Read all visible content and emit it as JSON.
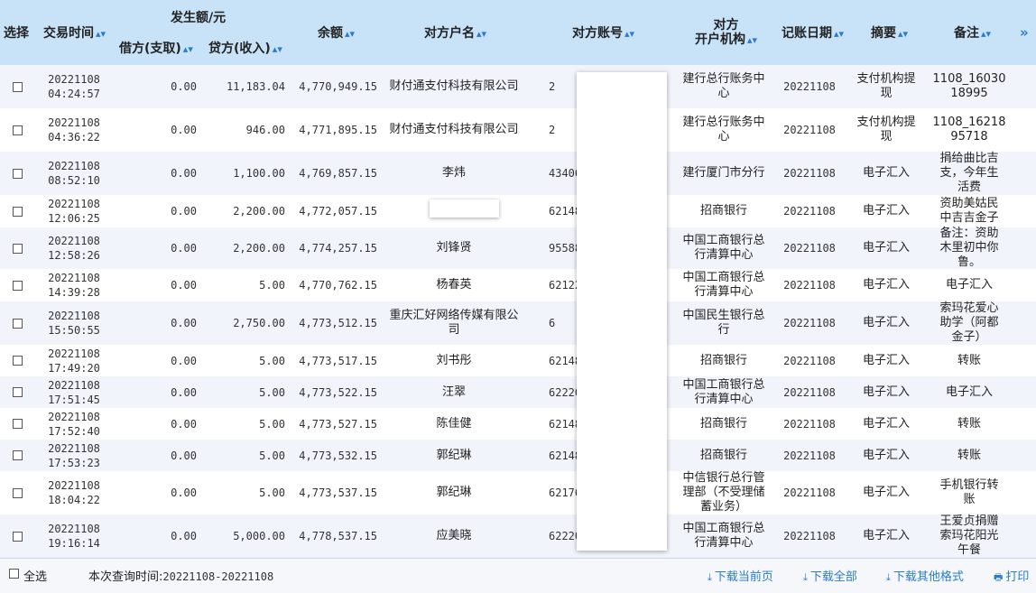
{
  "header": {
    "select": "选择",
    "time": "交易时间",
    "amount_group": "发生额/元",
    "debit": "借方(支取)",
    "credit": "贷方(收入)",
    "balance": "余额",
    "name": "对方户名",
    "account": "对方账号",
    "bank_line1": "对方",
    "bank_line2": "开户机构",
    "date": "记账日期",
    "summary": "摘要",
    "remark": "备注",
    "sort_glyph": "▴▾",
    "more": "»"
  },
  "rows": [
    {
      "d": "20221108",
      "t": "04:24:57",
      "debit": "0.00",
      "credit": "11,183.04",
      "balance": "4,770,949.15",
      "name": "财付通支付科技有限公司",
      "acct": "2",
      "bank": "建行总行账务中心",
      "date": "20221108",
      "summary": "支付机构提现",
      "remark": "1108_16030 18995"
    },
    {
      "d": "20221108",
      "t": "04:36:22",
      "debit": "0.00",
      "credit": "946.00",
      "balance": "4,771,895.15",
      "name": "财付通支付科技有限公司",
      "acct": "2",
      "bank": "建行总行账务中心",
      "date": "20221108",
      "summary": "支付机构提现",
      "remark": "1108_16218 95718"
    },
    {
      "d": "20221108",
      "t": "08:52:10",
      "debit": "0.00",
      "credit": "1,100.00",
      "balance": "4,769,857.15",
      "name": "李炜",
      "acct": "43406",
      "bank": "建行厦门市分行",
      "date": "20221108",
      "summary": "电子汇入",
      "remark": "捐给曲比吉支，今年生活费"
    },
    {
      "d": "20221108",
      "t": "12:06:25",
      "debit": "0.00",
      "credit": "2,200.00",
      "balance": "4,772,057.15",
      "name": "",
      "acct": "62148",
      "bank": "招商银行",
      "date": "20221108",
      "summary": "电子汇入",
      "remark": "资助美姑民中吉吉金子"
    },
    {
      "d": "20221108",
      "t": "12:58:26",
      "debit": "0.00",
      "credit": "2,200.00",
      "balance": "4,774,257.15",
      "name": "刘锋贤",
      "acct": "955880",
      "bank": "中国工商银行总行清算中心",
      "date": "20221108",
      "summary": "电子汇入",
      "remark": "备注：资助木里初中你鲁。"
    },
    {
      "d": "20221108",
      "t": "14:39:28",
      "debit": "0.00",
      "credit": "5.00",
      "balance": "4,770,762.15",
      "name": "杨春英",
      "acct": "621226",
      "bank": "中国工商银行总行清算中心",
      "date": "20221108",
      "summary": "电子汇入",
      "remark": "电子汇入"
    },
    {
      "d": "20221108",
      "t": "15:50:55",
      "debit": "0.00",
      "credit": "2,750.00",
      "balance": "4,773,512.15",
      "name": "重庆汇好网络传媒有限公司",
      "acct": "6",
      "bank": "中国民生银行总行",
      "date": "20221108",
      "summary": "电子汇入",
      "remark": "索玛花爱心助学（阿都金子）"
    },
    {
      "d": "20221108",
      "t": "17:49:20",
      "debit": "0.00",
      "credit": "5.00",
      "balance": "4,773,517.15",
      "name": "刘书彤",
      "acct": "62148",
      "bank": "招商银行",
      "date": "20221108",
      "summary": "电子汇入",
      "remark": "转账"
    },
    {
      "d": "20221108",
      "t": "17:51:45",
      "debit": "0.00",
      "credit": "5.00",
      "balance": "4,773,522.15",
      "name": "汪翠",
      "acct": "622202",
      "bank": "中国工商银行总行清算中心",
      "date": "20221108",
      "summary": "电子汇入",
      "remark": "电子汇入"
    },
    {
      "d": "20221108",
      "t": "17:52:40",
      "debit": "0.00",
      "credit": "5.00",
      "balance": "4,773,527.15",
      "name": "陈佳健",
      "acct": "62148",
      "bank": "招商银行",
      "date": "20221108",
      "summary": "电子汇入",
      "remark": "转账"
    },
    {
      "d": "20221108",
      "t": "17:53:23",
      "debit": "0.00",
      "credit": "5.00",
      "balance": "4,773,532.15",
      "name": "郭纪琳",
      "acct": "62148",
      "bank": "招商银行",
      "date": "20221108",
      "summary": "电子汇入",
      "remark": "转账"
    },
    {
      "d": "20221108",
      "t": "18:04:22",
      "debit": "0.00",
      "credit": "5.00",
      "balance": "4,773,537.15",
      "name": "郭纪琳",
      "acct": "62176",
      "bank": "中信银行总行管理部（不受理储蓄业务）",
      "date": "20221108",
      "summary": "电子汇入",
      "remark": "手机银行转账"
    },
    {
      "d": "20221108",
      "t": "19:16:14",
      "debit": "0.00",
      "credit": "5,000.00",
      "balance": "4,778,537.15",
      "name": "应美晓",
      "acct": "622208",
      "bank": "中国工商银行总行清算中心",
      "date": "20221108",
      "summary": "电子汇入",
      "remark": "王爱贞捐赠索玛花阳光午餐"
    }
  ],
  "footer": {
    "select_all": "全选",
    "query_label": "本次查询时间:",
    "query_range": "20221108-20221108",
    "download_icon": "⤓",
    "print_icon": "🖶",
    "download_page": "下载当前页",
    "download_all": "下载全部",
    "download_other": "下载其他格式",
    "print": "打印"
  }
}
